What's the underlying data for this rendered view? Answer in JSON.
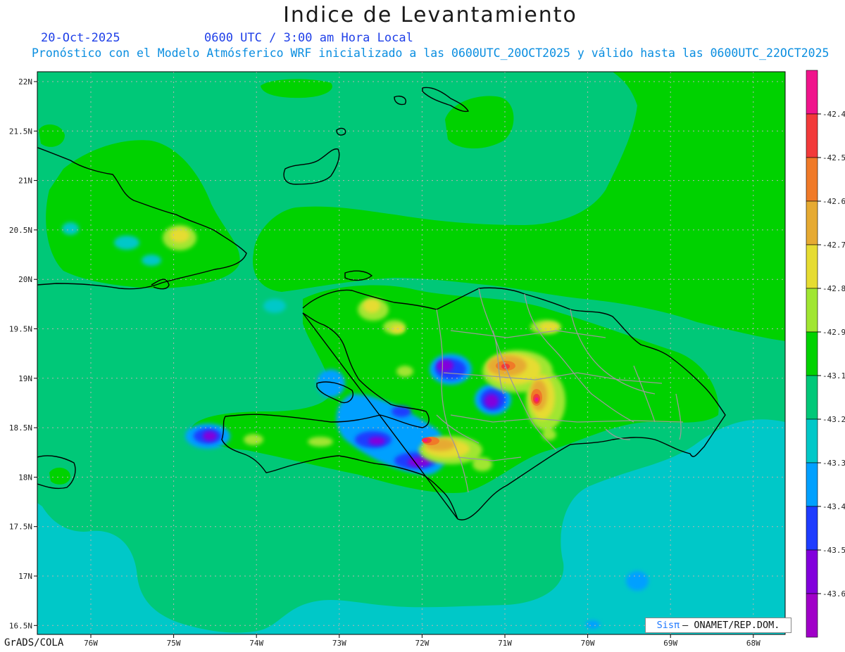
{
  "title": "Indice de Levantamiento",
  "date": "20-Oct-2025",
  "valid_time": "0600 UTC / 3:00 am Hora Local",
  "subtitle": "Pronóstico con el Modelo Atmósferico WRF inicializado a las 0600UTC_20OCT2025 y válido hasta las  0600UTC_22OCT2025",
  "footer": "GrADS/COLA",
  "credit": {
    "logo": "Sisπ",
    "text": "– ONAMET/REP.DOM."
  },
  "lat_labels": [
    "22N",
    "21.5N",
    "21N",
    "20.5N",
    "20N",
    "19.5N",
    "19N",
    "18.5N",
    "18N",
    "17.5N",
    "17N",
    "16.5N"
  ],
  "lon_labels": [
    "76W",
    "75W",
    "74W",
    "73W",
    "72W",
    "71W",
    "70W",
    "69W",
    "68W"
  ],
  "colorbar": {
    "labels": [
      "-42.4",
      "-42.5",
      "-42.6",
      "-42.7",
      "-42.8",
      "-42.9",
      "-43.1",
      "-43.2",
      "-43.3",
      "-43.4",
      "-43.5",
      "-43.6"
    ],
    "colors": [
      "#f0148c",
      "#f23a3a",
      "#f07a28",
      "#e6aa32",
      "#e6dc32",
      "#a0e632",
      "#00d200",
      "#00c878",
      "#00c8c8",
      "#00a0ff",
      "#1e3cff",
      "#8200dc",
      "#a000c8"
    ]
  }
}
